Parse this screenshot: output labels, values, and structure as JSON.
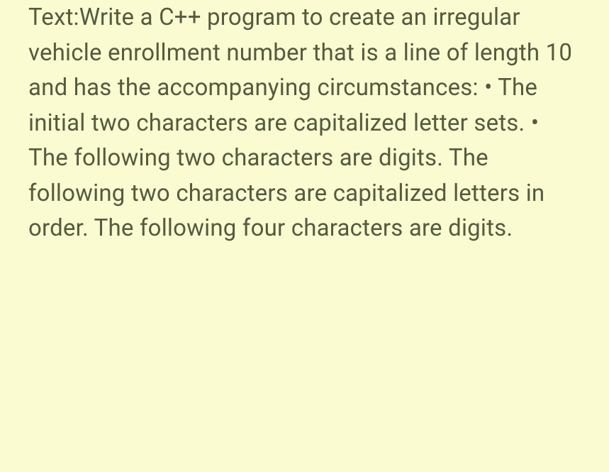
{
  "document": {
    "text": "Text:Write a C++ program to create an irregular vehicle enrollment number that is a line of length 10 and has the accompanying circumstances: • The initial two characters are capitalized letter sets. • The following two characters are digits. The following two characters are capitalized letters in order. The following four characters are digits."
  }
}
